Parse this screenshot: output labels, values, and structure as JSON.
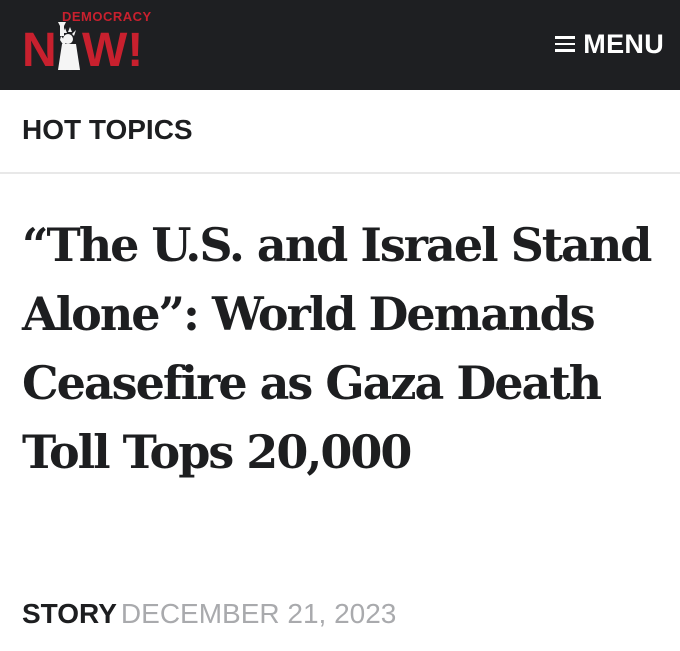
{
  "brand": {
    "top_text": "DEMOCRACY",
    "main_text": "NOW!",
    "accent_color": "#c8202e"
  },
  "header": {
    "menu_label": "MENU",
    "menu_icon": "hamburger-icon",
    "background": "#1e1f22"
  },
  "nav": {
    "hot_topics": "HOT TOPICS"
  },
  "article": {
    "headline": "“The U.S. and Israel Stand Alone”: World Demands Ceasefire as Gaza Death Toll Tops 20,000",
    "type": "STORY",
    "date": "DECEMBER 21, 2023"
  }
}
